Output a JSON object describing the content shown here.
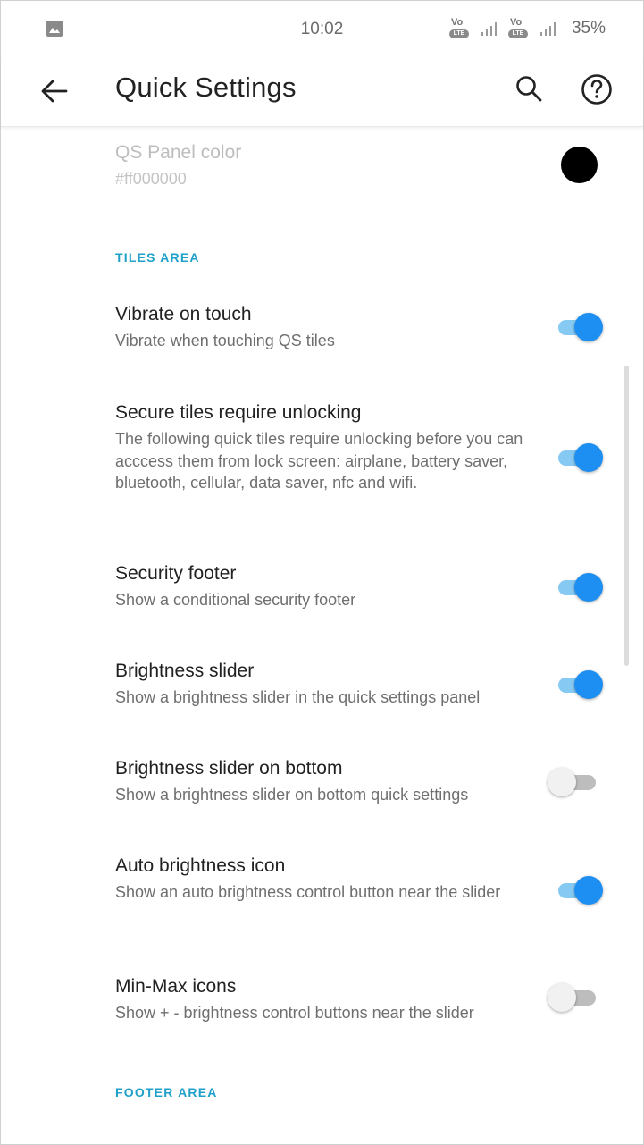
{
  "status_bar": {
    "time": "10:02",
    "battery": "35%",
    "volte_label": "Vo",
    "lte_label": "LTE",
    "icons": [
      "image-icon",
      "volte-icon",
      "signal-icon",
      "volte-icon",
      "signal-icon"
    ]
  },
  "app_bar": {
    "title": "Quick Settings",
    "icons": [
      "back-arrow-icon",
      "search-icon",
      "help-icon"
    ]
  },
  "qs_panel_color": {
    "title": "QS Panel color",
    "value": "#ff000000",
    "swatch_color": "#000000",
    "enabled": false
  },
  "sections": {
    "tiles_area": "TILES AREA",
    "footer_area": "FOOTER AREA"
  },
  "settings": [
    {
      "title": "Vibrate on touch",
      "summary": "Vibrate when touching QS tiles",
      "checked": true
    },
    {
      "title": "Secure tiles require unlocking",
      "summary": "The following quick tiles require unlocking before you can acccess them from lock screen: airplane, battery saver, bluetooth, cellular, data saver, nfc and wifi.",
      "checked": true
    },
    {
      "title": "Security footer",
      "summary": "Show a conditional security footer",
      "checked": true
    },
    {
      "title": "Brightness slider",
      "summary": "Show a brightness slider in the quick settings panel",
      "checked": true
    },
    {
      "title": "Brightness slider on bottom",
      "summary": "Show a brightness slider on bottom quick settings",
      "checked": false
    },
    {
      "title": "Auto brightness icon",
      "summary": "Show an auto brightness control button near the slider",
      "checked": true
    },
    {
      "title": "Min-Max icons",
      "summary": "Show + - brightness control buttons near the slider",
      "checked": false
    }
  ],
  "colors": {
    "accent": "#1e8ff2",
    "accent_track": "#86c9f2",
    "section_header": "#1fa0c8"
  }
}
